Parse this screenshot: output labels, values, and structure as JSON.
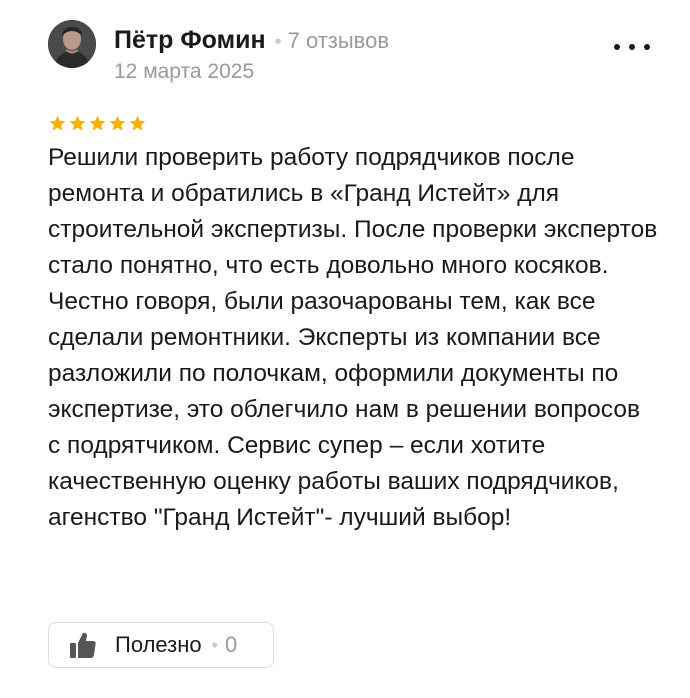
{
  "review": {
    "author": {
      "name": "Пётр Фомин",
      "reviews_count": "7 отзывов",
      "avatar_icon": "user-photo-avatar"
    },
    "date": "12 марта 2025",
    "rating": {
      "value": 5,
      "max": 5,
      "star_color": "#f6b400"
    },
    "text": "Решили проверить работу подрядчиков после ремонта и обратились в «Гранд Истейт» для строительной экспертизы. После проверки экспертов стало понятно, что есть довольно много косяков. Честно говоря, были разочарованы тем, как все сделали ремонтники. Эксперты из компании все разложили по полочкам, оформили документы по экспертизе, это облегчило нам в решении вопросов с подрятчиком. Сервис супер – если хотите качественную оценку работы ваших подрядчиков, агенство \"Гранд Истейт\"- лучший выбор!",
    "more_icon": "more-dots-icon",
    "useful": {
      "label": "Полезно",
      "count": "0",
      "icon": "thumbs-up-icon"
    }
  },
  "colors": {
    "text": "#1a1a1a",
    "muted": "#9a9a9a",
    "separator": "#c8c8c8",
    "star": "#f6b400",
    "border": "#dcdcdc"
  }
}
